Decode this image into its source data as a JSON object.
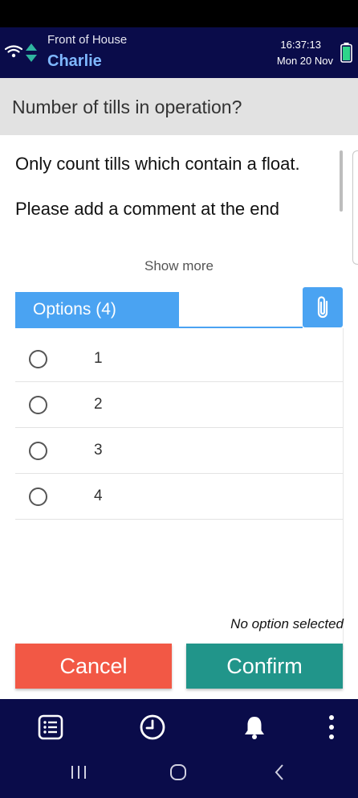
{
  "header": {
    "location": "Front of House",
    "user": "Charlie",
    "time": "16:37:13",
    "date": "Mon 20 Nov",
    "icons": [
      "wifi-icon",
      "sync-icon",
      "battery-icon"
    ]
  },
  "question": {
    "title": "Number of tills in operation?",
    "description_lines": [
      "Only count tills which contain a float.",
      "Please add a comment at the end"
    ],
    "show_more_label": "Show more"
  },
  "options_tab": {
    "label": "Options (4)",
    "attach_icon": "paperclip-icon"
  },
  "options": [
    {
      "label": "1",
      "selected": false
    },
    {
      "label": "2",
      "selected": false
    },
    {
      "label": "3",
      "selected": false
    },
    {
      "label": "4",
      "selected": false
    }
  ],
  "selection_status": "No option selected",
  "actions": {
    "cancel_label": "Cancel",
    "confirm_label": "Confirm"
  },
  "bottom_nav": {
    "items": [
      "list-icon",
      "clock-icon",
      "bell-icon",
      "more-vertical-icon"
    ]
  },
  "colors": {
    "header_bg": "#0a0c4a",
    "accent_blue": "#4aa3f2",
    "cancel": "#f25845",
    "confirm": "#21958a",
    "user_name": "#7fb8ff"
  }
}
